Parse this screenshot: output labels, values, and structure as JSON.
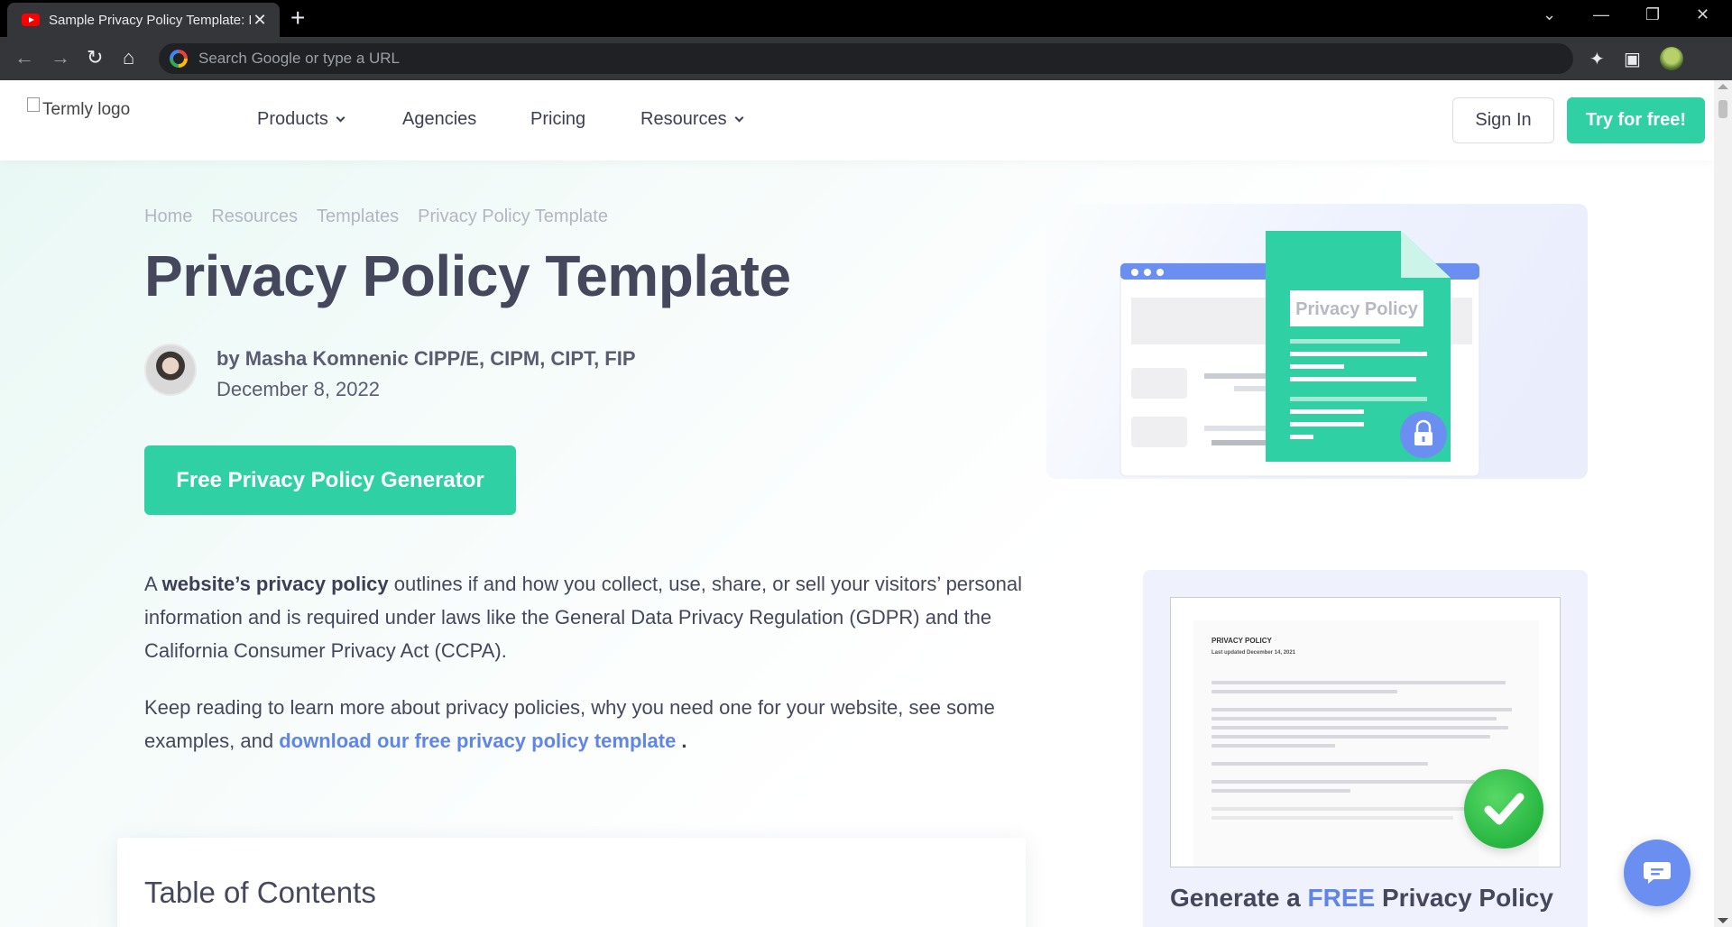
{
  "browser": {
    "tab_title": "Sample Privacy Policy Template: F",
    "tab_close": "✕",
    "new_tab": "+",
    "omnibox_placeholder": "Search Google or type a URL",
    "window_controls": {
      "tab_search": "⌄",
      "minimize": "—",
      "restore": "❐",
      "close": "✕"
    },
    "nav": {
      "back": "←",
      "forward": "→",
      "reload": "↻",
      "home": "⌂"
    },
    "toolbar_icons": {
      "extensions": "✦",
      "side_panel": "▣"
    }
  },
  "header": {
    "logo_alt": "Termly logo",
    "nav": [
      {
        "label": "Products",
        "has_dropdown": true
      },
      {
        "label": "Agencies",
        "has_dropdown": false
      },
      {
        "label": "Pricing",
        "has_dropdown": false
      },
      {
        "label": "Resources",
        "has_dropdown": true
      }
    ],
    "sign_in": "Sign In",
    "try_free": "Try for free!"
  },
  "breadcrumb": [
    "Home",
    "Resources",
    "Templates",
    "Privacy Policy Template"
  ],
  "hero": {
    "title": "Privacy Policy Template",
    "author": "by Masha Komnenic CIPP/E, CIPM, CIPT, FIP",
    "date": "December 8, 2022",
    "cta": "Free Privacy Policy Generator",
    "illustration_label": "Privacy Policy"
  },
  "intro": {
    "p1_pre": "A ",
    "p1_bold": "website’s privacy policy",
    "p1_post": " outlines if and how you collect, use, share, or sell your visitors’ personal information and is required under laws like the General Data Privacy Regulation (GDPR) and the California Consumer Privacy Act (CCPA).",
    "p2_pre": "Keep reading to learn more about privacy policies, why you need one for your website, see some examples, and ",
    "p2_link": "download our free privacy policy template",
    "p2_post": " ."
  },
  "toc": {
    "title": "Table of Contents"
  },
  "sidebar": {
    "doc_heading": "PRIVACY POLICY",
    "doc_updated": "Last updated December 14, 2021",
    "title_pre": "Generate a ",
    "title_free": "FREE",
    "title_post": " Privacy Policy"
  },
  "colors": {
    "brand_green": "#30d0a5",
    "link_blue": "#5f85e8",
    "heading": "#45475c",
    "chat_blue": "#6b8ff0"
  },
  "icons": [
    "youtube-favicon-icon",
    "google-g-icon",
    "puzzle-icon",
    "side-panel-icon",
    "profile-avatar-icon",
    "chevron-down-icon",
    "lock-icon",
    "checkmark-icon",
    "chat-icon"
  ]
}
